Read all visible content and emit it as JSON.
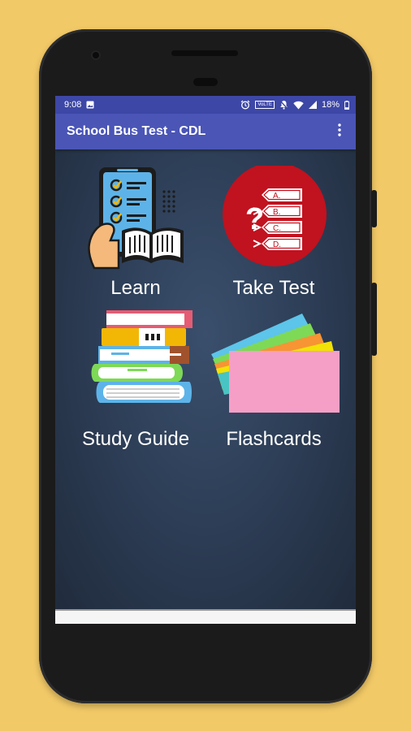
{
  "status_bar": {
    "time": "9:08",
    "battery": "18%",
    "icons": [
      "image-icon",
      "alarm-icon",
      "volte-icon",
      "mute-icon",
      "wifi-icon",
      "signal-icon",
      "battery-icon"
    ],
    "volte_label": "VoLTE"
  },
  "app_bar": {
    "title": "School Bus Test - CDL",
    "menu_icon": "more-vert-icon"
  },
  "tiles": [
    {
      "label": "Learn",
      "icon": "checklist-book-icon"
    },
    {
      "label": "Take Test",
      "icon": "multiple-choice-icon"
    },
    {
      "label": "Study Guide",
      "icon": "book-stack-icon"
    },
    {
      "label": "Flashcards",
      "icon": "flashcards-icon"
    }
  ],
  "colors": {
    "background": "#f2c967",
    "status_bar": "#3d47a6",
    "app_bar": "#4a55b6",
    "content_center": "#3a4f6c",
    "test_circle": "#c1121f"
  },
  "test_choices": [
    "A.",
    "B.",
    "C.",
    "D."
  ]
}
